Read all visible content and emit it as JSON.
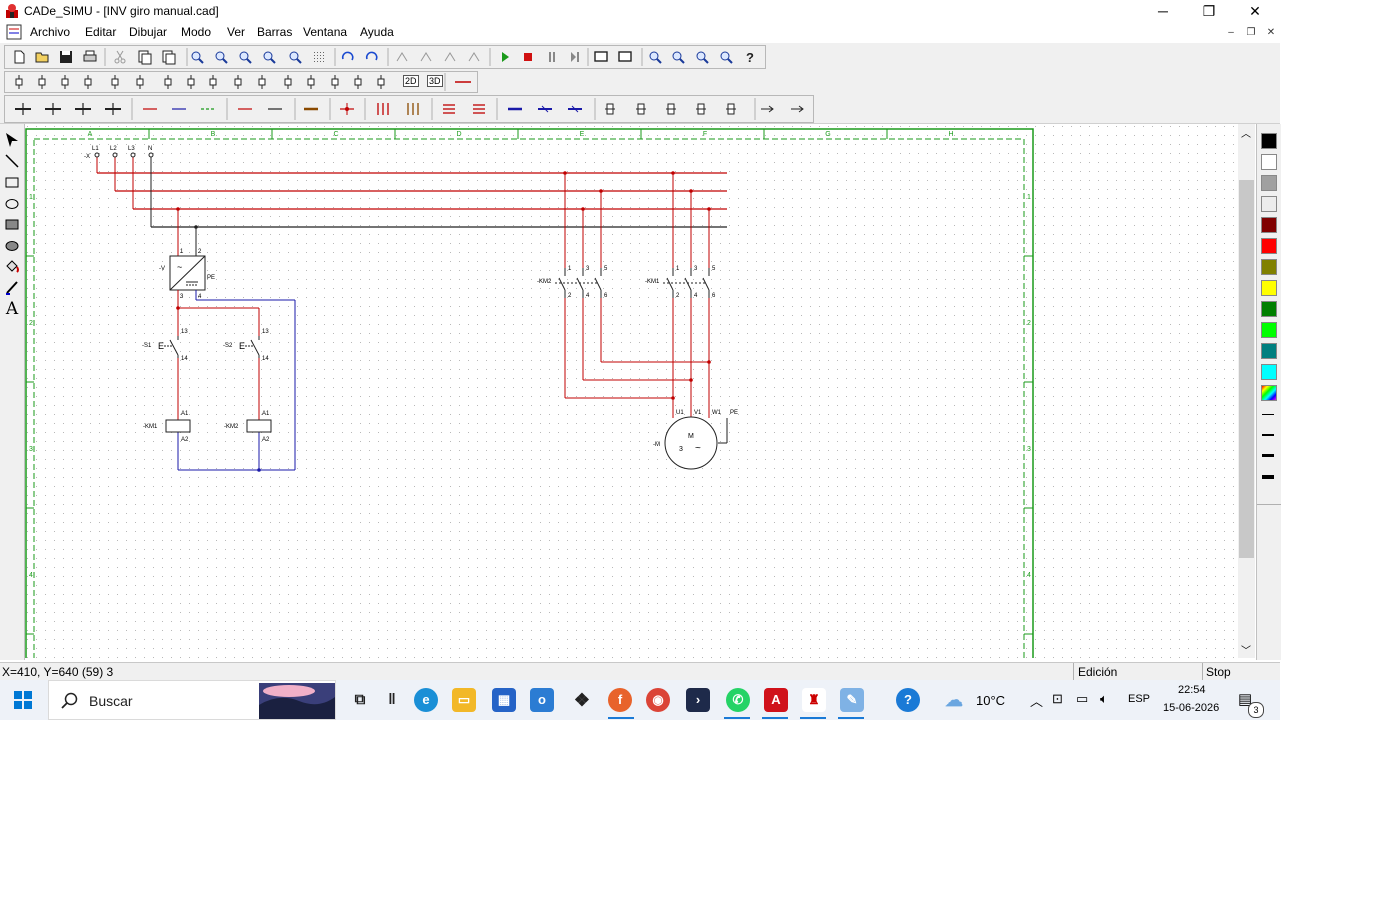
{
  "window": {
    "title": "CADe_SIMU - [INV giro manual.cad]",
    "min_glyph": "─",
    "max_glyph": "❐",
    "close_glyph": "✕",
    "mdi_min": "‒",
    "mdi_restore": "❐",
    "mdi_close": "✕"
  },
  "menu": [
    "Archivo",
    "Editar",
    "Dibujar",
    "Modo",
    "Ver",
    "Barras",
    "Ventana",
    "Ayuda"
  ],
  "toolbar1_icons": [
    "new-icon",
    "open-icon",
    "save-icon",
    "print-icon",
    "cut-icon",
    "copy-icon",
    "paste-icon",
    "find-icon",
    "find-next-icon",
    "zoom-window-icon",
    "zoom-fit-icon",
    "binoculars-icon",
    "grid-icon",
    "undo-icon",
    "redo-icon",
    "mirror-icon",
    "mirror-h-icon",
    "flip-icon",
    "arrow-icon",
    "play-icon",
    "stop-icon",
    "pause-icon",
    "step-icon",
    "screen-icon",
    "select-screen-icon",
    "zoom-in-icon",
    "zoom-out-icon",
    "zoom-page-icon",
    "zoom-plus-icon",
    "help-icon"
  ],
  "toolbar2": {
    "label_2d": "2D",
    "label_3d": "3D"
  },
  "drawing": {
    "columns": [
      "A",
      "B",
      "C",
      "D",
      "E",
      "F",
      "G",
      "H"
    ],
    "rows": [
      "1",
      "2",
      "3",
      "4"
    ],
    "lines": [
      "L1",
      "L2",
      "L3",
      "N"
    ],
    "supply_tag": "-X",
    "power_supply_tag": "-V",
    "pe": "PE",
    "s1": "-S1",
    "s2": "-S2",
    "km1": "-KM1",
    "km2": "-KM2",
    "motor_tag": "-M",
    "motor_m": "M",
    "motor_3": "3",
    "motor_tilde": "~",
    "motor_terms": [
      "U1",
      "V1",
      "W1",
      "PE"
    ],
    "term_13": "13",
    "term_14": "14",
    "term_a1": "A1",
    "term_a2": "A2",
    "ps_terms": [
      "1",
      "2",
      "3",
      "4"
    ],
    "contact_top": [
      "1",
      "3",
      "5"
    ],
    "contact_bot": [
      "2",
      "4",
      "6"
    ],
    "e_glyph": "E"
  },
  "colors": {
    "red": "#c00000",
    "blue": "#1a1aa8",
    "black": "#222222",
    "frame": "#1a9a1a",
    "palette": [
      "#000000",
      "#ffffff",
      "#a0a0a0",
      "#ececec",
      "#800000",
      "#ff0000",
      "#808000",
      "#ffff00",
      "#008000",
      "#00ff00",
      "#008080",
      "#00ffff",
      "rainbow"
    ]
  },
  "status": {
    "coords": "X=410, Y=640 (59) 3",
    "mode": "Edición",
    "sim": "Stop"
  },
  "taskbar": {
    "search": "Buscar",
    "temp": "10°C",
    "lang": "ESP",
    "time": "22:54",
    "date": "15-06-2026",
    "notif_count": "3"
  }
}
